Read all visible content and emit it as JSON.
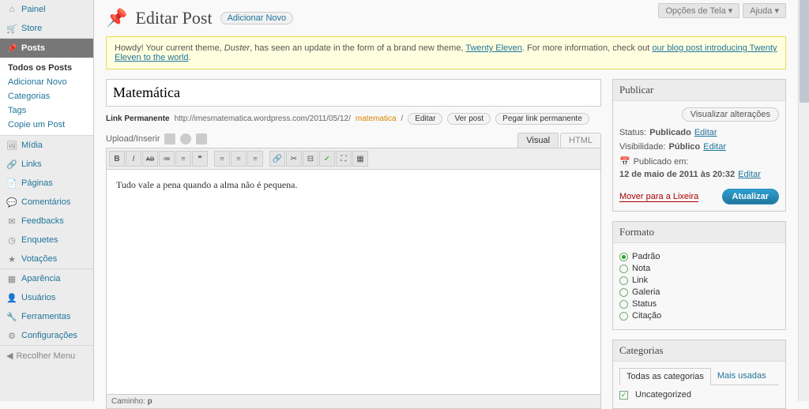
{
  "screenOptions": {
    "screen": "Opções de Tela ▾",
    "help": "Ajuda ▾"
  },
  "sidebar": {
    "sec1": [
      {
        "icon": "⌂",
        "label": "Painel"
      },
      {
        "icon": "🛒",
        "label": "Store"
      }
    ],
    "sec2": {
      "active": {
        "icon": "✎",
        "label": "Posts"
      },
      "sub": [
        "Todos os Posts",
        "Adicionar Novo",
        "Categorias",
        "Tags",
        "Copie um Post"
      ]
    },
    "sec3": [
      {
        "icon": "🖼",
        "label": "Mídia"
      },
      {
        "icon": "🔗",
        "label": "Links"
      },
      {
        "icon": "📄",
        "label": "Páginas"
      },
      {
        "icon": "💬",
        "label": "Comentários"
      },
      {
        "icon": "✉",
        "label": "Feedbacks"
      },
      {
        "icon": "◷",
        "label": "Enquetes"
      },
      {
        "icon": "★",
        "label": "Votações"
      }
    ],
    "sec4": [
      {
        "icon": "▦",
        "label": "Aparência"
      },
      {
        "icon": "👤",
        "label": "Usuários"
      },
      {
        "icon": "🔧",
        "label": "Ferramentas"
      },
      {
        "icon": "⚙",
        "label": "Configurações"
      }
    ],
    "collapse": "Recolher Menu"
  },
  "page": {
    "title": "Editar Post",
    "addNew": "Adicionar Novo"
  },
  "notice": {
    "t1": "Howdy! Your current theme, ",
    "theme": "Duster",
    "t2": ", has seen an update in the form of a brand new theme, ",
    "link1": "Twenty Eleven",
    "t3": ". For more information, check out ",
    "link2": "our blog post introducing Twenty Eleven to the world",
    "t4": "."
  },
  "post": {
    "title": "Matemática",
    "permalinkLabel": "Link Permanente",
    "permalinkBase": "http://imesmatematica.wordpress.com/2011/05/12/",
    "slug": "matematica",
    "btnEdit": "Editar",
    "btnView": "Ver post",
    "btnGetlink": "Pegar link permanente",
    "uploadLabel": "Upload/Inserir",
    "tabVisual": "Visual",
    "tabHtml": "HTML",
    "content": "Tudo vale a pena quando a alma não é pequena.",
    "pathLabel": "Caminho:",
    "pathVal": "p"
  },
  "publish": {
    "heading": "Publicar",
    "preview": "Visualizar alterações",
    "statusLabel": "Status:",
    "statusVal": "Publicado",
    "edit": "Editar",
    "visLabel": "Visibilidade:",
    "visVal": "Público",
    "pubOnLabel": "Publicado em:",
    "pubOnVal": "12 de maio de 2011 às 20:32",
    "trash": "Mover para a Lixeira",
    "update": "Atualizar"
  },
  "format": {
    "heading": "Formato",
    "options": [
      "Padrão",
      "Nota",
      "Link",
      "Galeria",
      "Status",
      "Citação"
    ],
    "selected": 0
  },
  "categories": {
    "heading": "Categorias",
    "tabAll": "Todas as categorias",
    "tabMost": "Mais usadas",
    "items": [
      {
        "label": "Uncategorized",
        "checked": true
      }
    ]
  }
}
